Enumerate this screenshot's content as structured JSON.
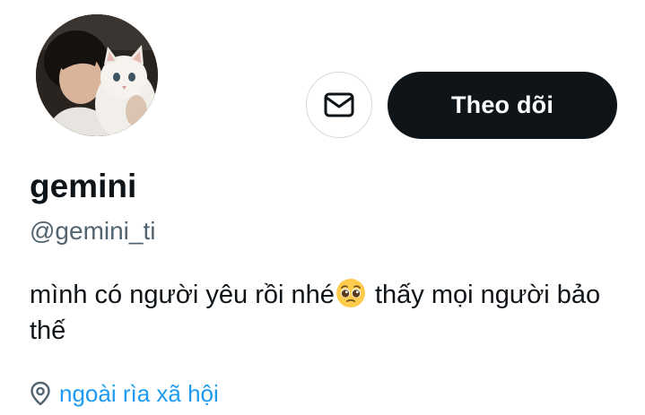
{
  "profile": {
    "display_name": "gemini",
    "handle": "@gemini_ti",
    "bio_part1": "mình có người yêu rồi nhé",
    "bio_emoji": "pleading-face-emoji",
    "bio_part2": " thấy mọi người bảo thế",
    "location": "ngoài rìa xã hội"
  },
  "actions": {
    "follow_label": "Theo dõi",
    "message_icon": "envelope-icon"
  },
  "icons": {
    "location": "map-pin-icon"
  },
  "colors": {
    "text_primary": "#0f1419",
    "text_secondary": "#536471",
    "link": "#1d9bf0",
    "button_dark": "#0f1419",
    "border": "#cfd9de"
  }
}
